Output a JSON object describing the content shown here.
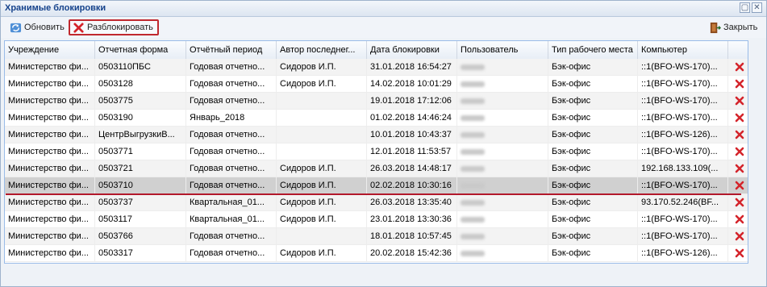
{
  "window": {
    "title": "Хранимые блокировки"
  },
  "toolbar": {
    "refresh_label": "Обновить",
    "unlock_label": "Разблокировать",
    "close_label": "Закрыть"
  },
  "columns": [
    "Учреждение",
    "Отчетная форма",
    "Отчётный период",
    "Автор последнег...",
    "Дата блокировки",
    "Пользователь",
    "Тип рабочего места",
    "Компьютер"
  ],
  "rows": [
    {
      "org": "Министерство фи...",
      "form": "0503110ПБС",
      "period": "Годовая отчетно...",
      "author": "Сидоров И.П.",
      "date": "31.01.2018 16:54:27",
      "wtype": "Бэк-офис",
      "pc": "::1(BFO-WS-170)..."
    },
    {
      "org": "Министерство фи...",
      "form": "0503128",
      "period": "Годовая отчетно...",
      "author": "Сидоров И.П.",
      "date": "14.02.2018 10:01:29",
      "wtype": "Бэк-офис",
      "pc": "::1(BFO-WS-170)..."
    },
    {
      "org": "Министерство фи...",
      "form": "0503775",
      "period": "Годовая отчетно...",
      "author": "",
      "date": "19.01.2018 17:12:06",
      "wtype": "Бэк-офис",
      "pc": "::1(BFO-WS-170)..."
    },
    {
      "org": "Министерство фи...",
      "form": "0503190",
      "period": "Январь_2018",
      "author": "",
      "date": "01.02.2018 14:46:24",
      "wtype": "Бэк-офис",
      "pc": "::1(BFO-WS-170)..."
    },
    {
      "org": "Министерство фи...",
      "form": "ЦентрВыгрузкиВ...",
      "period": "Годовая отчетно...",
      "author": "",
      "date": "10.01.2018 10:43:37",
      "wtype": "Бэк-офис",
      "pc": "::1(BFO-WS-126)..."
    },
    {
      "org": "Министерство фи...",
      "form": "0503771",
      "period": "Годовая отчетно...",
      "author": "",
      "date": "12.01.2018 11:53:57",
      "wtype": "Бэк-офис",
      "pc": "::1(BFO-WS-170)..."
    },
    {
      "org": "Министерство фи...",
      "form": "0503721",
      "period": "Годовая отчетно...",
      "author": "Сидоров И.П.",
      "date": "26.03.2018 14:48:17",
      "wtype": "Бэк-офис",
      "pc": "192.168.133.109(..."
    },
    {
      "org": "Министерство фи...",
      "form": "0503710",
      "period": "Годовая отчетно...",
      "author": "Сидоров И.П.",
      "date": "02.02.2018 10:30:16",
      "wtype": "Бэк-офис",
      "pc": "::1(BFO-WS-170)..."
    },
    {
      "org": "Министерство фи...",
      "form": "0503737",
      "period": "Квартальная_01...",
      "author": "Сидоров И.П.",
      "date": "26.03.2018 13:35:40",
      "wtype": "Бэк-офис",
      "pc": "93.170.52.246(BF..."
    },
    {
      "org": "Министерство фи...",
      "form": "0503117",
      "period": "Квартальная_01...",
      "author": "Сидоров И.П.",
      "date": "23.01.2018 13:30:36",
      "wtype": "Бэк-офис",
      "pc": "::1(BFO-WS-170)..."
    },
    {
      "org": "Министерство фи...",
      "form": "0503766",
      "period": "Годовая отчетно...",
      "author": "",
      "date": "18.01.2018 10:57:45",
      "wtype": "Бэк-офис",
      "pc": "::1(BFO-WS-170)..."
    },
    {
      "org": "Министерство фи...",
      "form": "0503317",
      "period": "Годовая отчетно...",
      "author": "Сидоров И.П.",
      "date": "20.02.2018 15:42:36",
      "wtype": "Бэк-офис",
      "pc": "::1(BFO-WS-126)..."
    }
  ],
  "selected_row": 7,
  "colors": {
    "accent_red": "#c0282e",
    "header_text": "#15428b",
    "selected_bg": "#d0d0d0"
  },
  "icons": {
    "refresh": "refresh-icon",
    "unlock": "red-x-icon",
    "close": "door-exit-icon",
    "row_delete": "red-x-icon"
  }
}
